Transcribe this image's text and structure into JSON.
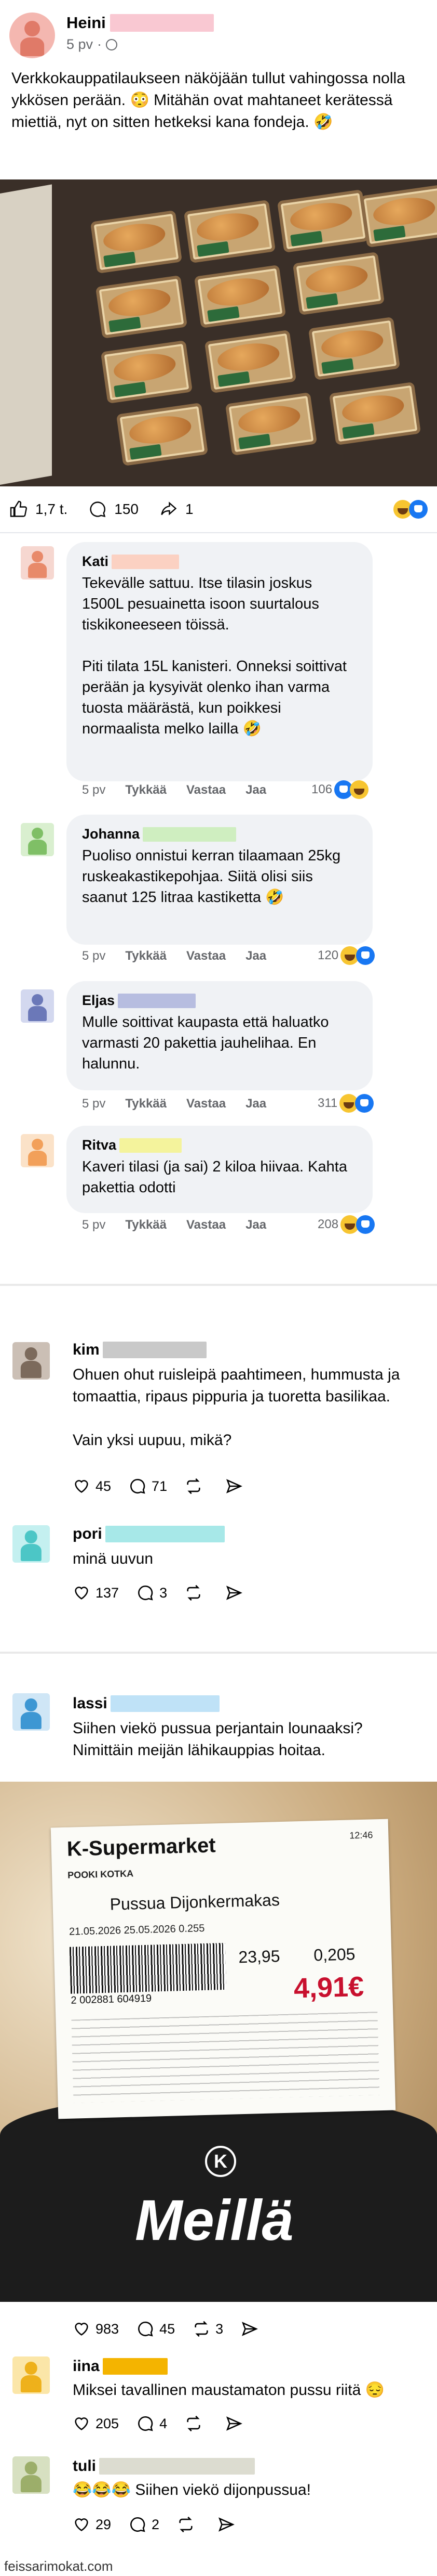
{
  "post": {
    "author": "Heini",
    "time": "5 pv",
    "text": "Verkkokauppatilaukseen näköjään tullut vahingossa nolla ykkösen perään. 😳 Mitähän ovat mahtaneet kerätessä miettiä, nyt on sitten hetkeksi kana fondeja. 🤣",
    "likes": "1,7 t.",
    "comments": "150",
    "shares": "1"
  },
  "comments": [
    {
      "name": "Kati",
      "text": "Tekevälle sattuu. Itse tilasin joskus 1500L pesuainetta isoon suurtalous tiskikoneeseen töissä.\n\nPiti tilata 15L kanisteri. Onneksi soittivat perään ja kysyivät olenko ihan varma tuosta määrästä, kun poikkesi normaalista melko lailla 🤣",
      "time": "5 pv",
      "like": "Tykkää",
      "reply": "Vastaa",
      "share": "Jaa",
      "count": "106"
    },
    {
      "name": "Johanna",
      "text": "Puoliso onnistui kerran tilaamaan 25kg ruskeakastikepohjaa. Siitä olisi siis saanut 125 litraa kastiketta 🤣",
      "time": "5 pv",
      "like": "Tykkää",
      "reply": "Vastaa",
      "share": "Jaa",
      "count": "120"
    },
    {
      "name": "Eljas",
      "text": "Mulle soittivat kaupasta että haluatko varmasti 20 pakettia jauhelihaa. En halunnu.",
      "time": "5 pv",
      "like": "Tykkää",
      "reply": "Vastaa",
      "share": "Jaa",
      "count": "311"
    },
    {
      "name": "Ritva",
      "text": "Kaveri tilasi (ja sai) 2 kiloa hiivaa. Kahta pakettia odotti",
      "time": "5 pv",
      "like": "Tykkää",
      "reply": "Vastaa",
      "share": "Jaa",
      "count": "208"
    }
  ],
  "thread1": {
    "name": "kim",
    "text": "Ohuen ohut ruisleipä paahtimeen, hummusta ja tomaattia, ripaus pippuria ja tuoretta basilikaa.\n\nVain yksi uupuu, mikä?",
    "likes": "45",
    "replies": "71",
    "reply_name": "pori",
    "reply_text": "minä uuvun",
    "reply_likes": "137",
    "reply_replies": "3"
  },
  "thread2": {
    "name": "lassi",
    "text": "Siihen viekö pussua perjantain lounaaksi? Nimittäin meijän lähikauppias hoitaa.",
    "likes": "983",
    "replies": "45",
    "reposts": "3",
    "label_brand": "K-Supermarket",
    "label_dept": "POOKI KOTKA",
    "label_product": "Pussua Dijonkermakas",
    "label_dates": "21.05.2026   25.05.2026   0.255",
    "label_kg": "23,95",
    "label_weight": "0,205",
    "label_price": "4,91€",
    "label_barcode": "2 002881 604919",
    "label_time": "12:46",
    "bag_text": "Meillä",
    "r1_name": "iina",
    "r1_text": "Miksei tavallinen maustamaton pussu riitä 😔",
    "r1_likes": "205",
    "r1_replies": "4",
    "r2_name": "tuli",
    "r2_text": "😂😂😂 Siihen viekö dijonpussua!",
    "r2_likes": "29",
    "r2_replies": "2"
  },
  "footer": "feissarimokat.com"
}
